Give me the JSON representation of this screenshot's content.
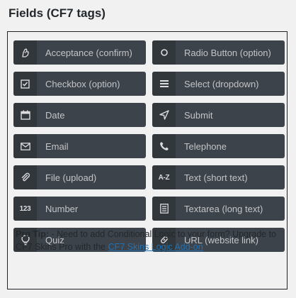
{
  "panel": {
    "title": "Fields (CF7 tags)"
  },
  "tags": [
    {
      "label": "Acceptance (confirm)",
      "icon": "hand-icon"
    },
    {
      "label": "Radio Button (option)",
      "icon": "radio-icon"
    },
    {
      "label": "Checkbox (option)",
      "icon": "checkbox-icon"
    },
    {
      "label": "Select (dropdown)",
      "icon": "menu-lines-icon"
    },
    {
      "label": "Date",
      "icon": "calendar-icon"
    },
    {
      "label": "Submit",
      "icon": "send-arrow-icon"
    },
    {
      "label": "Email",
      "icon": "envelope-icon"
    },
    {
      "label": "Telephone",
      "icon": "phone-icon"
    },
    {
      "label": "File (upload)",
      "icon": "paperclip-icon"
    },
    {
      "label": "Text (short text)",
      "icon": "a-z-icon",
      "icon_text": "A-Z"
    },
    {
      "label": "Number",
      "icon": "number-icon",
      "icon_text": "123"
    },
    {
      "label": "Textarea (long text)",
      "icon": "document-icon"
    },
    {
      "label": "Quiz",
      "icon": "lightbulb-icon"
    },
    {
      "label": "URL (website link)",
      "icon": "link-icon"
    }
  ],
  "tip": {
    "prefix": "Pro Tip:",
    "text": " - Need to add Conditional Logic to your form? Upgrade to CF7 Skins Pro with the ",
    "link": "CF7 Skins Logic Add-on"
  },
  "colors": {
    "button_bg": "#3c434a",
    "icon_bg": "#32373c",
    "link": "#2271b1"
  }
}
